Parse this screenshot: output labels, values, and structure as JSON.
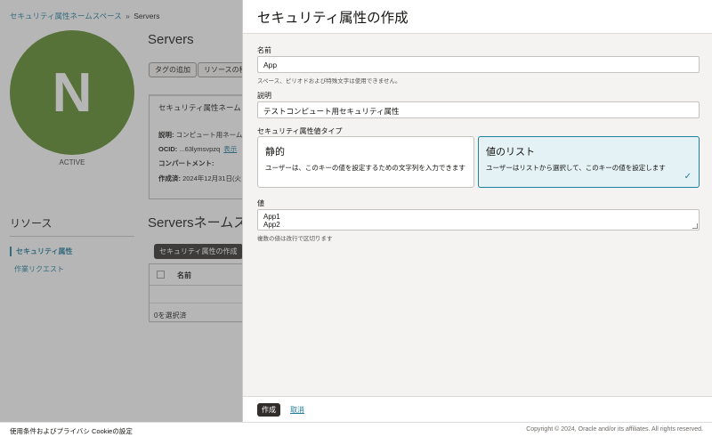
{
  "breadcrumb": {
    "parent": "セキュリティ属性ネームスペース",
    "separator": "»",
    "current": "Servers"
  },
  "avatar": {
    "letter": "N",
    "status": "ACTIVE",
    "color": "#5a8a26"
  },
  "page": {
    "title": "Servers",
    "buttons": [
      "タグの追加",
      "リソースの移"
    ],
    "info_title": "セキュリティ属性ネーム",
    "info": {
      "desc_label": "説明:",
      "desc_value": "コンピュート用ネーム",
      "ocid_label": "OCID:",
      "ocid_value": "...63lymsvpzq",
      "ocid_link": "表示",
      "compartment_label": "コンパートメント:",
      "created_label": "作成済:",
      "created_value": "2024年12月31日(火"
    },
    "resources_title": "リソース",
    "resources": [
      "セキュリティ属性",
      "作業リクエスト"
    ],
    "section_title": "Serversネームス",
    "section_button": "セキュリティ属性の作成",
    "table_column": "名前",
    "selected_count": "0を選択済"
  },
  "panel": {
    "title": "セキュリティ属性の作成",
    "name_label": "名前",
    "name_value": "App",
    "name_hint": "スペース、ピリオドおよび特殊文字は使用できません。",
    "desc_label": "説明",
    "desc_value": "テストコンピュート用セキュリティ属性",
    "type_label": "セキュリティ属性値タイプ",
    "cards": [
      {
        "title": "静的",
        "description": "ユーザーは、このキーの値を設定するための文字列を入力できます"
      },
      {
        "title": "値のリスト",
        "description": "ユーザーはリストから選択して、このキーの値を設定します"
      }
    ],
    "values_label": "値",
    "values": [
      "App1",
      "App2"
    ],
    "values_hint": "複数の値は改行で区切ります",
    "create_label": "作成",
    "cancel_label": "取消"
  },
  "footer": {
    "terms": "使用条件およびプライバシ",
    "cookies": "Cookieの設定",
    "copyright": "Copyright © 2024, Oracle and/or its affiliates. All rights reserved."
  }
}
